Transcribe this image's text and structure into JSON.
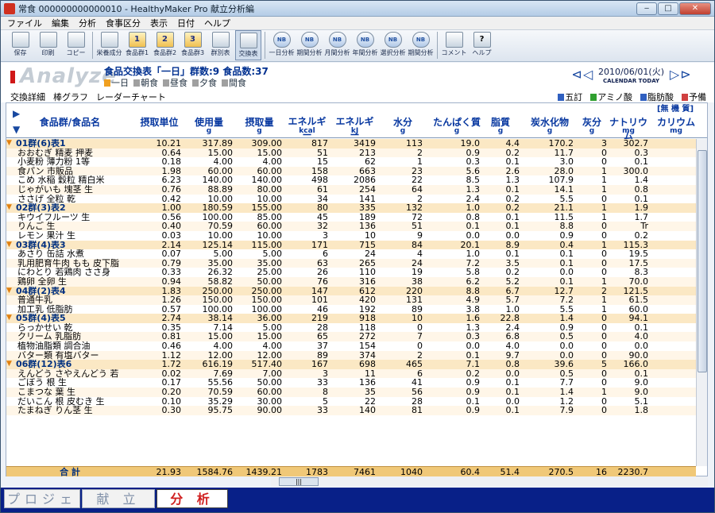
{
  "window": {
    "title": "常食 000000000000010 - HealthyMaker Pro 献立分析編"
  },
  "menu": [
    "ファイル",
    "編集",
    "分析",
    "食事区分",
    "表示",
    "日付",
    "ヘルプ"
  ],
  "toolbar": [
    {
      "label": "保存",
      "icon": "save-icon",
      "type": "plain"
    },
    {
      "label": "印刷",
      "icon": "print-icon",
      "type": "plain"
    },
    {
      "label": "コピー",
      "icon": "copy-icon",
      "type": "plain"
    },
    {
      "label": "栄養成分",
      "icon": "table-icon",
      "type": "plain"
    },
    {
      "label": "食品群1",
      "icon": "1",
      "type": "num"
    },
    {
      "label": "食品群2",
      "icon": "2",
      "type": "num"
    },
    {
      "label": "食品群3",
      "icon": "3",
      "type": "num"
    },
    {
      "label": "群別表",
      "icon": "table-icon",
      "type": "plain"
    },
    {
      "label": "交換表",
      "icon": "table-icon",
      "type": "sel"
    },
    {
      "label": "一日分析",
      "icon": "NB",
      "type": "cloud"
    },
    {
      "label": "期間分析",
      "icon": "NB",
      "type": "cloud"
    },
    {
      "label": "月間分析",
      "icon": "NB",
      "type": "cloud"
    },
    {
      "label": "年間分析",
      "icon": "NB",
      "type": "cloud"
    },
    {
      "label": "選択分析",
      "icon": "NB",
      "type": "cloud"
    },
    {
      "label": "期間分析",
      "icon": "NB",
      "type": "cloud"
    },
    {
      "label": "コメント",
      "icon": "comment-icon",
      "type": "plain"
    },
    {
      "label": "ヘルプ",
      "icon": "?",
      "type": "plain"
    }
  ],
  "header": {
    "logo": "Analyze",
    "info": "食品交換表「一日」群数:9 食品数:37",
    "meals": [
      "一日",
      "朝食",
      "昼食",
      "夕食",
      "間食"
    ],
    "date": "2010/06/01(火)",
    "calendar_label": "CALENDAR",
    "today_label": "TODAY"
  },
  "options": {
    "left": [
      "交換詳細",
      "棒グラフ",
      "レーダーチャート"
    ],
    "right": [
      "五訂",
      "アミノ酸",
      "脂肪酸",
      "予備"
    ]
  },
  "columns": [
    {
      "name": "食品群/食品名",
      "unit": ""
    },
    {
      "name": "摂取単位",
      "unit": ""
    },
    {
      "name": "使用量",
      "unit": "g"
    },
    {
      "name": "摂取量",
      "unit": "g"
    },
    {
      "name": "エネルギー",
      "unit": "kcal"
    },
    {
      "name": "エネルギー",
      "unit": "kJ"
    },
    {
      "name": "水分",
      "unit": "g"
    },
    {
      "name": "たんぱく質",
      "unit": "g"
    },
    {
      "name": "脂質",
      "unit": "g"
    },
    {
      "name": "炭水化物",
      "unit": "g"
    },
    {
      "name": "灰分",
      "unit": "g"
    },
    {
      "name": "ナトリウム",
      "unit": "mg"
    },
    {
      "name": "カリウム",
      "unit": "mg"
    }
  ],
  "group_header": "[無 機 質]",
  "rows": [
    {
      "g": true,
      "n": "01群(6)表1",
      "v": [
        "10.21",
        "317.89",
        "309.00",
        "817",
        "3419",
        "113",
        "19.0",
        "4.4",
        "170.2",
        "3",
        "302.7"
      ]
    },
    {
      "n": "おおむぎ 精麦 押麦",
      "v": [
        "0.64",
        "15.00",
        "15.00",
        "51",
        "213",
        "2",
        "0.9",
        "0.2",
        "11.7",
        "0",
        "0.3"
      ]
    },
    {
      "n": "小麦粉 薄力粉 1等",
      "v": [
        "0.18",
        "4.00",
        "4.00",
        "15",
        "62",
        "1",
        "0.3",
        "0.1",
        "3.0",
        "0",
        "0.1"
      ]
    },
    {
      "n": "食パン 市販品",
      "v": [
        "1.98",
        "60.00",
        "60.00",
        "158",
        "663",
        "23",
        "5.6",
        "2.6",
        "28.0",
        "1",
        "300.0"
      ]
    },
    {
      "n": "こめ 水稲 穀粒 精白米",
      "v": [
        "6.23",
        "140.00",
        "140.00",
        "498",
        "2086",
        "22",
        "8.5",
        "1.3",
        "107.9",
        "1",
        "1.4"
      ]
    },
    {
      "n": "じゃがいも 塊茎 生",
      "v": [
        "0.76",
        "88.89",
        "80.00",
        "61",
        "254",
        "64",
        "1.3",
        "0.1",
        "14.1",
        "1",
        "0.8"
      ]
    },
    {
      "n": "ささげ 全粒 乾",
      "v": [
        "0.42",
        "10.00",
        "10.00",
        "34",
        "141",
        "2",
        "2.4",
        "0.2",
        "5.5",
        "0",
        "0.1"
      ]
    },
    {
      "g": true,
      "n": "02群(3)表2",
      "v": [
        "1.00",
        "180.59",
        "155.00",
        "80",
        "335",
        "132",
        "1.0",
        "0.2",
        "21.1",
        "1",
        "1.9"
      ]
    },
    {
      "n": "キウイフルーツ 生",
      "v": [
        "0.56",
        "100.00",
        "85.00",
        "45",
        "189",
        "72",
        "0.8",
        "0.1",
        "11.5",
        "1",
        "1.7"
      ]
    },
    {
      "n": "りんご 生",
      "v": [
        "0.40",
        "70.59",
        "60.00",
        "32",
        "136",
        "51",
        "0.1",
        "0.1",
        "8.8",
        "0",
        "Tr"
      ]
    },
    {
      "n": "レモン 果汁 生",
      "v": [
        "0.03",
        "10.00",
        "10.00",
        "3",
        "10",
        "9",
        "0.0",
        "0.0",
        "0.9",
        "0",
        "0.2"
      ]
    },
    {
      "g": true,
      "n": "03群(4)表3",
      "v": [
        "2.14",
        "125.14",
        "115.00",
        "171",
        "715",
        "84",
        "20.1",
        "8.9",
        "0.4",
        "1",
        "115.3"
      ]
    },
    {
      "n": "あさり 缶詰 水煮",
      "v": [
        "0.07",
        "5.00",
        "5.00",
        "6",
        "24",
        "4",
        "1.0",
        "0.1",
        "0.1",
        "0",
        "19.5"
      ]
    },
    {
      "n": "乳用肥育牛肉 もも 皮下脂",
      "v": [
        "0.79",
        "35.00",
        "35.00",
        "63",
        "265",
        "24",
        "7.2",
        "3.5",
        "0.1",
        "0",
        "17.5"
      ]
    },
    {
      "n": "にわとり 若鶏肉 ささ身",
      "v": [
        "0.33",
        "26.32",
        "25.00",
        "26",
        "110",
        "19",
        "5.8",
        "0.2",
        "0.0",
        "0",
        "8.3"
      ]
    },
    {
      "n": "鶏卵 全卵 生",
      "v": [
        "0.94",
        "58.82",
        "50.00",
        "76",
        "316",
        "38",
        "6.2",
        "5.2",
        "0.1",
        "1",
        "70.0"
      ]
    },
    {
      "g": true,
      "n": "04群(2)表4",
      "v": [
        "1.83",
        "250.00",
        "250.00",
        "147",
        "612",
        "220",
        "8.8",
        "6.7",
        "12.7",
        "2",
        "121.5"
      ]
    },
    {
      "n": "普通牛乳",
      "v": [
        "1.26",
        "150.00",
        "150.00",
        "101",
        "420",
        "131",
        "4.9",
        "5.7",
        "7.2",
        "1",
        "61.5"
      ]
    },
    {
      "n": "加工乳 低脂肪",
      "v": [
        "0.57",
        "100.00",
        "100.00",
        "46",
        "192",
        "89",
        "3.8",
        "1.0",
        "5.5",
        "1",
        "60.0"
      ]
    },
    {
      "g": true,
      "n": "05群(4)表5",
      "v": [
        "2.74",
        "38.14",
        "36.00",
        "219",
        "918",
        "10",
        "1.6",
        "22.8",
        "1.4",
        "0",
        "94.1"
      ]
    },
    {
      "n": "らっかせい 乾",
      "v": [
        "0.35",
        "7.14",
        "5.00",
        "28",
        "118",
        "0",
        "1.3",
        "2.4",
        "0.9",
        "0",
        "0.1"
      ]
    },
    {
      "n": "クリーム 乳脂肪",
      "v": [
        "0.81",
        "15.00",
        "15.00",
        "65",
        "272",
        "7",
        "0.3",
        "6.8",
        "0.5",
        "0",
        "4.0"
      ]
    },
    {
      "n": "植物油脂類 調合油",
      "v": [
        "0.46",
        "4.00",
        "4.00",
        "37",
        "154",
        "0",
        "0.0",
        "4.0",
        "0.0",
        "0",
        "0.0"
      ]
    },
    {
      "n": "バター類 有塩バター",
      "v": [
        "1.12",
        "12.00",
        "12.00",
        "89",
        "374",
        "2",
        "0.1",
        "9.7",
        "0.0",
        "0",
        "90.0"
      ]
    },
    {
      "g": true,
      "n": "06群(12)表6",
      "v": [
        "1.72",
        "616.19",
        "517.40",
        "167",
        "698",
        "465",
        "7.1",
        "0.8",
        "39.6",
        "5",
        "166.0"
      ]
    },
    {
      "n": "えんどう さやえんどう 若",
      "v": [
        "0.02",
        "7.69",
        "7.00",
        "3",
        "11",
        "6",
        "0.2",
        "0.0",
        "0.5",
        "0",
        "0.1"
      ]
    },
    {
      "n": "ごぼう 根 生",
      "v": [
        "0.17",
        "55.56",
        "50.00",
        "33",
        "136",
        "41",
        "0.9",
        "0.1",
        "7.7",
        "0",
        "9.0"
      ]
    },
    {
      "n": "こまつな 葉 生",
      "v": [
        "0.20",
        "70.59",
        "60.00",
        "8",
        "35",
        "56",
        "0.9",
        "0.1",
        "1.4",
        "1",
        "9.0"
      ]
    },
    {
      "n": "だいこん 根 皮むき 生",
      "v": [
        "0.10",
        "35.29",
        "30.00",
        "5",
        "22",
        "28",
        "0.1",
        "0.0",
        "1.2",
        "0",
        "5.1"
      ]
    },
    {
      "n": "たまねぎ りん茎 生",
      "v": [
        "0.30",
        "95.75",
        "90.00",
        "33",
        "140",
        "81",
        "0.9",
        "0.1",
        "7.9",
        "0",
        "1.8"
      ]
    }
  ],
  "total": {
    "label": "合 計",
    "v": [
      "21.93",
      "1584.76",
      "1439.21",
      "1783",
      "7461",
      "1040",
      "60.4",
      "51.4",
      "270.5",
      "16",
      "2230.7"
    ]
  },
  "tabs": [
    "プロジェクト",
    "献 立",
    "分 析"
  ],
  "active_tab": 2
}
